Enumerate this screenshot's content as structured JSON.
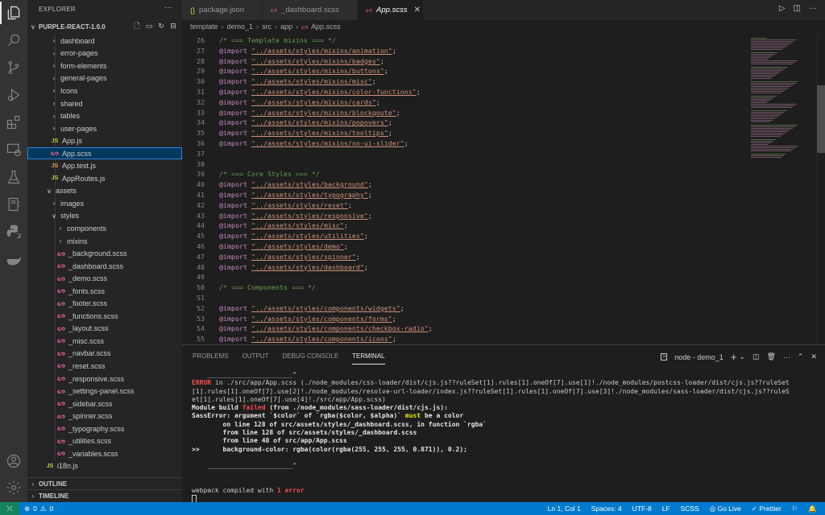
{
  "activity_bar": {
    "items": [
      "explorer",
      "search",
      "source-control",
      "run-debug",
      "extensions",
      "remote-explorer",
      "testing",
      "notebook",
      "python",
      "docker"
    ],
    "bottom": [
      "accounts",
      "settings"
    ]
  },
  "sidebar": {
    "title": "EXPLORER",
    "more": "···",
    "project": "PURPLE-REACT-1.0.0",
    "tree": [
      {
        "label": "dashboard",
        "type": "folder",
        "open": false,
        "depth": 2
      },
      {
        "label": "error-pages",
        "type": "folder",
        "open": false,
        "depth": 2
      },
      {
        "label": "form-elements",
        "type": "folder",
        "open": false,
        "depth": 2
      },
      {
        "label": "general-pages",
        "type": "folder",
        "open": false,
        "depth": 2
      },
      {
        "label": "Icons",
        "type": "folder",
        "open": false,
        "depth": 2
      },
      {
        "label": "shared",
        "type": "folder",
        "open": false,
        "depth": 2
      },
      {
        "label": "tables",
        "type": "folder",
        "open": false,
        "depth": 2
      },
      {
        "label": "user-pages",
        "type": "folder",
        "open": false,
        "depth": 2
      },
      {
        "label": "App.js",
        "type": "js",
        "depth": 2
      },
      {
        "label": "App.scss",
        "type": "scss",
        "depth": 2,
        "selected": true
      },
      {
        "label": "App.test.js",
        "type": "jsx",
        "depth": 2
      },
      {
        "label": "AppRoutes.js",
        "type": "js",
        "depth": 2
      },
      {
        "label": "assets",
        "type": "folder",
        "open": true,
        "depth": 1
      },
      {
        "label": "images",
        "type": "folder",
        "open": false,
        "depth": 2
      },
      {
        "label": "styles",
        "type": "folder",
        "open": true,
        "depth": 2
      },
      {
        "label": "components",
        "type": "folder",
        "open": false,
        "depth": 3
      },
      {
        "label": "mixins",
        "type": "folder",
        "open": false,
        "depth": 3
      },
      {
        "label": "_background.scss",
        "type": "scss",
        "depth": 3
      },
      {
        "label": "_dashboard.scss",
        "type": "scss",
        "depth": 3
      },
      {
        "label": "_demo.scss",
        "type": "scss",
        "depth": 3
      },
      {
        "label": "_fonts.scss",
        "type": "scss",
        "depth": 3
      },
      {
        "label": "_footer.scss",
        "type": "scss",
        "depth": 3
      },
      {
        "label": "_functions.scss",
        "type": "scss",
        "depth": 3
      },
      {
        "label": "_layout.scss",
        "type": "scss",
        "depth": 3
      },
      {
        "label": "_misc.scss",
        "type": "scss",
        "depth": 3
      },
      {
        "label": "_navbar.scss",
        "type": "scss",
        "depth": 3
      },
      {
        "label": "_reset.scss",
        "type": "scss",
        "depth": 3
      },
      {
        "label": "_responsive.scss",
        "type": "scss",
        "depth": 3
      },
      {
        "label": "_settings-panel.scss",
        "type": "scss",
        "depth": 3
      },
      {
        "label": "_sidebar.scss",
        "type": "scss",
        "depth": 3
      },
      {
        "label": "_spinner.scss",
        "type": "scss",
        "depth": 3
      },
      {
        "label": "_typography.scss",
        "type": "scss",
        "depth": 3
      },
      {
        "label": "_utilities.scss",
        "type": "scss",
        "depth": 3
      },
      {
        "label": "_variables.scss",
        "type": "scss",
        "depth": 3
      },
      {
        "label": "i18n.js",
        "type": "js",
        "depth": 1
      }
    ],
    "sections": {
      "outline": "OUTLINE",
      "timeline": "TIMELINE"
    }
  },
  "tabs": [
    {
      "label": "package.json",
      "icon": "{}",
      "active": false
    },
    {
      "label": "_dashboard.scss",
      "icon": "scss",
      "active": false
    },
    {
      "label": "App.scss",
      "icon": "scss",
      "active": true
    }
  ],
  "breadcrumb": [
    "template",
    "demo_1",
    "src",
    "app",
    "App.scss"
  ],
  "editor": {
    "lines": [
      {
        "n": "26",
        "kind": "comment",
        "text": "/* === Template mixins === */"
      },
      {
        "n": "27",
        "kind": "import",
        "path": "\"../assets/styles/mixins/animation\""
      },
      {
        "n": "28",
        "kind": "import",
        "path": "\"../assets/styles/mixins/badges\""
      },
      {
        "n": "29",
        "kind": "import",
        "path": "\"../assets/styles/mixins/buttons\""
      },
      {
        "n": "30",
        "kind": "import",
        "path": "\"../assets/styles/mixins/misc\""
      },
      {
        "n": "31",
        "kind": "import",
        "path": "\"../assets/styles/mixins/color-functions\""
      },
      {
        "n": "32",
        "kind": "import",
        "path": "\"../assets/styles/mixins/cards\""
      },
      {
        "n": "33",
        "kind": "import",
        "path": "\"../assets/styles/mixins/blockqoute\""
      },
      {
        "n": "34",
        "kind": "import",
        "path": "\"../assets/styles/mixins/popovers\""
      },
      {
        "n": "35",
        "kind": "import",
        "path": "\"../assets/styles/mixins/tooltips\""
      },
      {
        "n": "36",
        "kind": "import",
        "path": "\"../assets/styles/mixins/no-ui-slider\""
      },
      {
        "n": "37",
        "kind": "blank"
      },
      {
        "n": "38",
        "kind": "blank"
      },
      {
        "n": "39",
        "kind": "comment",
        "text": "/* === Core Styles === */"
      },
      {
        "n": "40",
        "kind": "import",
        "path": "\"../assets/styles/background\""
      },
      {
        "n": "41",
        "kind": "import",
        "path": "\"../assets/styles/typography\""
      },
      {
        "n": "42",
        "kind": "import",
        "path": "\"../assets/styles/reset\""
      },
      {
        "n": "43",
        "kind": "import",
        "path": "\"../assets/styles/responsive\""
      },
      {
        "n": "44",
        "kind": "import",
        "path": "\"../assets/styles/misc\""
      },
      {
        "n": "45",
        "kind": "import",
        "path": "\"../assets/styles/utilities\""
      },
      {
        "n": "46",
        "kind": "import",
        "path": "\"../assets/styles/demo\""
      },
      {
        "n": "47",
        "kind": "import",
        "path": "\"../assets/styles/spinner\""
      },
      {
        "n": "48",
        "kind": "import",
        "path": "\"../assets/styles/dashboard\""
      },
      {
        "n": "49",
        "kind": "blank"
      },
      {
        "n": "50",
        "kind": "comment",
        "text": "/* === Components === */"
      },
      {
        "n": "51",
        "kind": "blank"
      },
      {
        "n": "52",
        "kind": "import",
        "path": "\"../assets/styles/components/widgets\""
      },
      {
        "n": "53",
        "kind": "import",
        "path": "\"../assets/styles/components/forms\""
      },
      {
        "n": "54",
        "kind": "import",
        "path": "\"../assets/styles/components/checkbox-radio\""
      },
      {
        "n": "55",
        "kind": "import",
        "path": "\"../assets/styles/components/icons\""
      }
    ],
    "keyword": "@import"
  },
  "panel": {
    "tabs": [
      "PROBLEMS",
      "OUTPUT",
      "DEBUG CONSOLE",
      "TERMINAL"
    ],
    "active_tab": "TERMINAL",
    "terminal_name": "node - demo_1",
    "lines": [
      {
        "segs": [
          {
            "t": "    ______________________^"
          }
        ]
      },
      {
        "segs": [
          {
            "t": "ERROR",
            "c": "red"
          },
          {
            "t": " in ./src/app/App.scss (./node_modules/css-loader/dist/cjs.js??ruleSet[1].rules[1].oneOf[7].use[1]!./node_modules/postcss-loader/dist/cjs.js??ruleSet"
          }
        ]
      },
      {
        "segs": [
          {
            "t": "[1].rules[1].oneOf[7].use[2]!./node_modules/resolve-url-loader/index.js??ruleSet[1].rules[1].oneOf[7].use[3]!./node_modules/sass-loader/dist/cjs.js??ruleS"
          }
        ]
      },
      {
        "segs": [
          {
            "t": "et[1].rules[1].oneOf[7].use[4]!./src/app/App.scss)"
          }
        ]
      },
      {
        "segs": [
          {
            "t": "Module build ",
            "c": "bold"
          },
          {
            "t": "failed",
            "c": "red"
          },
          {
            "t": " (from ./node_modules/sass-loader/dist/cjs.js):",
            "c": "bold"
          }
        ]
      },
      {
        "segs": [
          {
            "t": "SassError: argument `$color` of `rgba($color, $alpha)` ",
            "c": "bold"
          },
          {
            "t": "must",
            "c": "yel"
          },
          {
            "t": " be a color",
            "c": "bold"
          }
        ]
      },
      {
        "segs": [
          {
            "t": "        on line 128 of src/assets/styles/_dashboard.scss, in function `rgba`",
            "c": "bold"
          }
        ]
      },
      {
        "segs": [
          {
            "t": "        from line 128 of src/assets/styles/_dashboard.scss",
            "c": "bold"
          }
        ]
      },
      {
        "segs": [
          {
            "t": "        from line 48 of src/app/App.scss",
            "c": "bold"
          }
        ]
      },
      {
        "segs": [
          {
            "t": ">>      background-color: rgba(color(rgba(255, 255, 255, 0.871)), 0.2);",
            "c": "bold"
          }
        ]
      },
      {
        "segs": [
          {
            "t": ""
          }
        ]
      },
      {
        "segs": [
          {
            "t": "    ______________________^"
          }
        ]
      },
      {
        "segs": [
          {
            "t": ""
          }
        ]
      },
      {
        "segs": [
          {
            "t": ""
          }
        ]
      },
      {
        "segs": [
          {
            "t": "webpack compiled with "
          },
          {
            "t": "1 error",
            "c": "red"
          }
        ]
      }
    ]
  },
  "status_bar": {
    "errors": "0",
    "warnings": "0",
    "position": "Ln 1, Col 1",
    "spaces": "Spaces: 4",
    "encoding": "UTF-8",
    "eol": "LF",
    "language": "SCSS",
    "go_live": "Go Live",
    "prettier": "Prettier"
  },
  "colors": {
    "accent": "#007acc",
    "remote": "#16825d",
    "error": "#f14c4c",
    "scss": "#c6538c",
    "js": "#cbcb41"
  }
}
